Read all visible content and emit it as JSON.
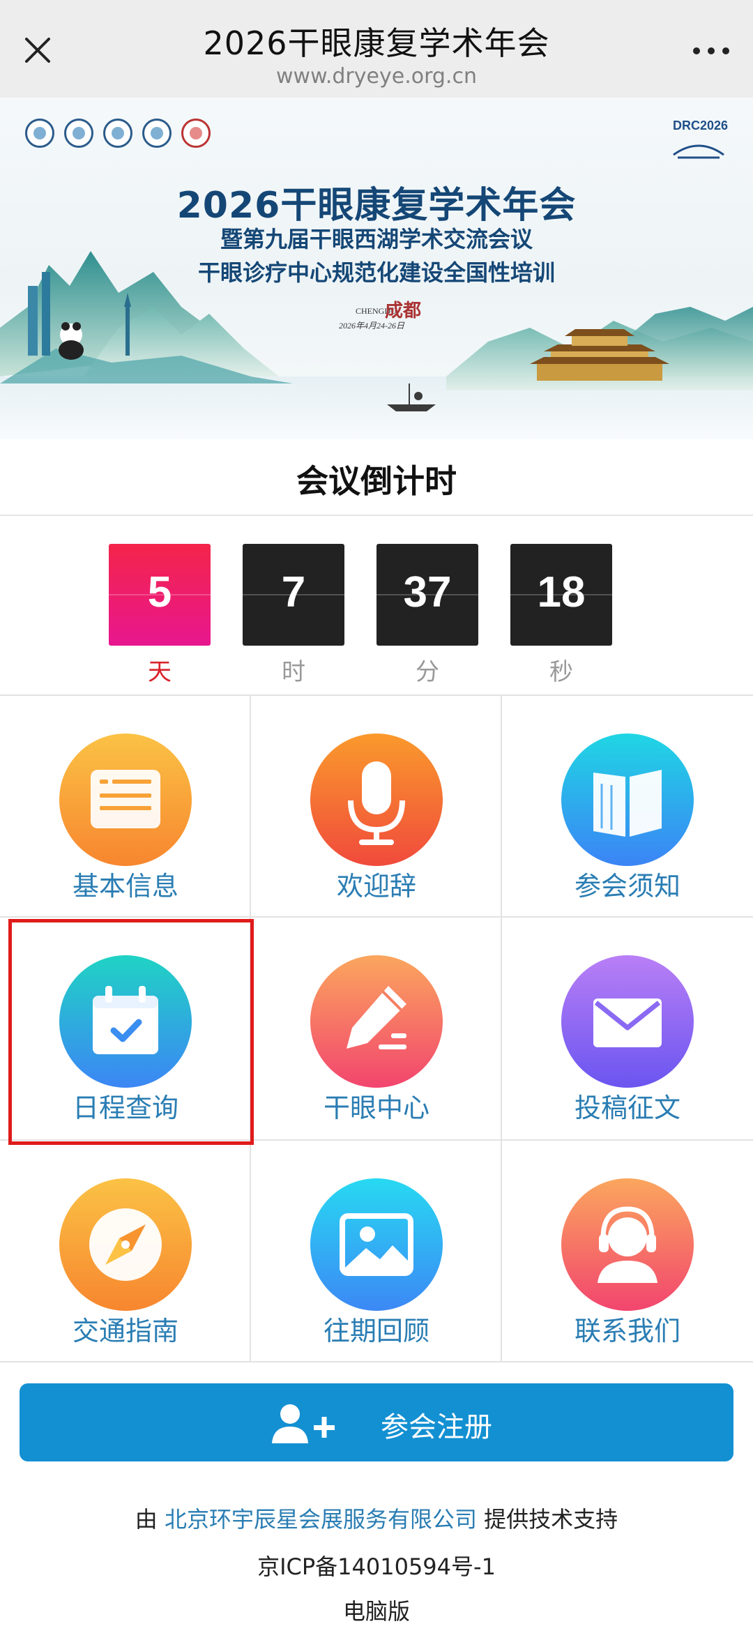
{
  "titlebar": {
    "title": "2026干眼康复学术年会",
    "url": "www.dryeye.org.cn"
  },
  "banner": {
    "title": "2026干眼康复学术年会",
    "subtitle1": "暨第九届干眼西湖学术交流会议",
    "subtitle2": "干眼诊疗中心规范化建设全国性培训",
    "date": "2026年4月24-26日",
    "city_en": "CHENGDU",
    "drc": "DRC2026"
  },
  "countdown": {
    "title": "会议倒计时",
    "days": "5",
    "hours": "7",
    "minutes": "37",
    "seconds": "18",
    "days_unit": "天",
    "hours_unit": "时",
    "minutes_unit": "分",
    "seconds_unit": "秒"
  },
  "menu": [
    {
      "label": "基本信息",
      "icon": "document-icon",
      "color_top": "#fbb43a",
      "color_bottom": "#f7862f"
    },
    {
      "label": "欢迎辞",
      "icon": "microphone-icon",
      "color_top": "#f98c2b",
      "color_bottom": "#f2553a"
    },
    {
      "label": "参会须知",
      "icon": "book-icon",
      "color_top": "#21d3e5",
      "color_bottom": "#3a86f5"
    },
    {
      "label": "日程查询",
      "icon": "calendar-icon",
      "color_top": "#22d0c8",
      "color_bottom": "#3b8af5"
    },
    {
      "label": "干眼中心",
      "icon": "edit-icon",
      "color_top": "#fb9f61",
      "color_bottom": "#f2476c"
    },
    {
      "label": "投稿征文",
      "icon": "mail-icon",
      "color_top": "#b27cf6",
      "color_bottom": "#6f58f1"
    },
    {
      "label": "交通指南",
      "icon": "compass-icon",
      "color_top": "#fbb43a",
      "color_bottom": "#f7862f"
    },
    {
      "label": "往期回顾",
      "icon": "image-icon",
      "color_top": "#2ad6f2",
      "color_bottom": "#3b8bf5"
    },
    {
      "label": "联系我们",
      "icon": "support-agent-icon",
      "color_top": "#fb9f61",
      "color_bottom": "#f2476c"
    }
  ],
  "register": {
    "label": "参会注册",
    "icon": "add-user-icon"
  },
  "footer": {
    "prefix": "由",
    "company": "北京环宇辰星会展服务有限公司",
    "suffix": "提供技术支持",
    "icp": "京ICP备14010594号-1",
    "desktop": "电脑版"
  },
  "colors": {
    "accent": "#1390d2",
    "link": "#2a7db3",
    "countdown_day": "#e8168f",
    "highlight": "#e01b1b"
  }
}
